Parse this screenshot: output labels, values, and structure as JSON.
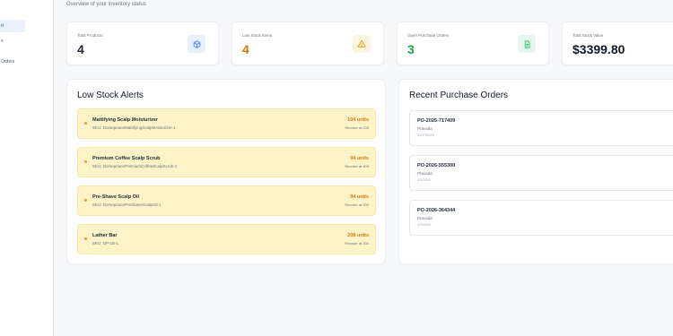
{
  "sidebar": {
    "items": [
      {
        "label": "d",
        "active": true
      },
      {
        "label": "s",
        "active": false
      },
      {
        "label": "Orders",
        "active": false
      },
      {
        "label": "",
        "active": false
      }
    ]
  },
  "header": {
    "subtitle": "Overview of your inventory status"
  },
  "stats": [
    {
      "label": "Total Products",
      "value": "4",
      "value_color": "#1f2937",
      "icon": "cube-icon",
      "icon_color": "#3b82f6",
      "icon_bg": "#e8f0fe"
    },
    {
      "label": "Low Stock Items",
      "value": "4",
      "value_color": "#d97706",
      "icon": "warning-icon",
      "icon_color": "#f59e0b",
      "icon_bg": "#fef4e2"
    },
    {
      "label": "Open Purchase Orders",
      "value": "3",
      "value_color": "#16a34a",
      "icon": "document-icon",
      "icon_color": "#22c55e",
      "icon_bg": "#e6f6ec"
    },
    {
      "label": "Total Stock Value",
      "value": "$3399.80",
      "value_color": "#111827"
    }
  ],
  "low_stock": {
    "title": "Low Stock Alerts",
    "items": [
      {
        "name": "Mattifying Scalp Moisturizer",
        "sku": "SKU: DomepeaceMattifyingScalpMoisturizer-1",
        "units": "104 units",
        "reorder": "Reorder at 230"
      },
      {
        "name": "Premium Coffee Scalp Scrub",
        "sku": "SKU: DomepeacePremiumCoffeeScalpScrub-1",
        "units": "94 units",
        "reorder": "Reorder at 400"
      },
      {
        "name": "Pre-Shave Scalp Oil",
        "sku": "SKU: DomepeacePreShaveScalpOil-1",
        "units": "94 units",
        "reorder": "Reorder at 300"
      },
      {
        "name": "Lather Bar",
        "sku": "SKU: DP-LB-1",
        "units": "208 units",
        "reorder": "Reorder at 300"
      }
    ]
  },
  "purchase_orders": {
    "title": "Recent Purchase Orders",
    "items": [
      {
        "id": "PO-2025-717409",
        "vendor": "Pravada",
        "date": "11/17/2025"
      },
      {
        "id": "PO-2026-555300",
        "vendor": "Pravada",
        "date": "1/7/2026"
      },
      {
        "id": "PO-2026-364344",
        "vendor": "Pravada",
        "date": "1/7/2026"
      }
    ]
  }
}
